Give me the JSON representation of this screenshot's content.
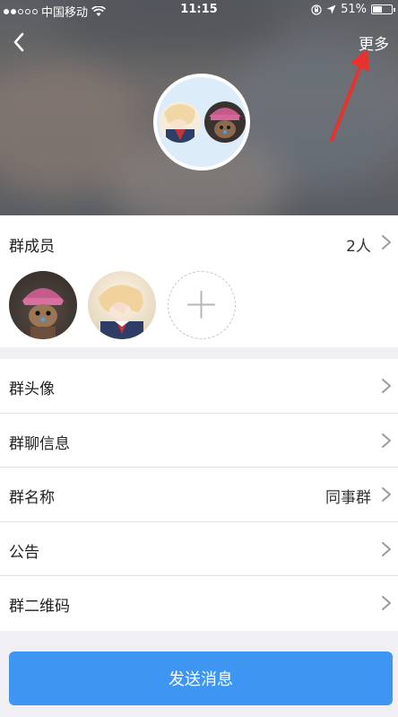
{
  "status_bar": {
    "carrier": "中国移动",
    "time": "11:15",
    "battery": "51%",
    "battery_level": 0.51
  },
  "nav": {
    "more_label": "更多"
  },
  "members": {
    "title": "群成员",
    "count": "2人"
  },
  "settings": {
    "items": [
      {
        "label": "群头像",
        "value": ""
      },
      {
        "label": "群聊信息",
        "value": ""
      },
      {
        "label": "群名称",
        "value": "同事群"
      },
      {
        "label": "公告",
        "value": ""
      },
      {
        "label": "群二维码",
        "value": ""
      }
    ]
  },
  "send_button": "发送消息",
  "colors": {
    "accent": "#3f95f2",
    "annotation_arrow": "#e8322d"
  }
}
